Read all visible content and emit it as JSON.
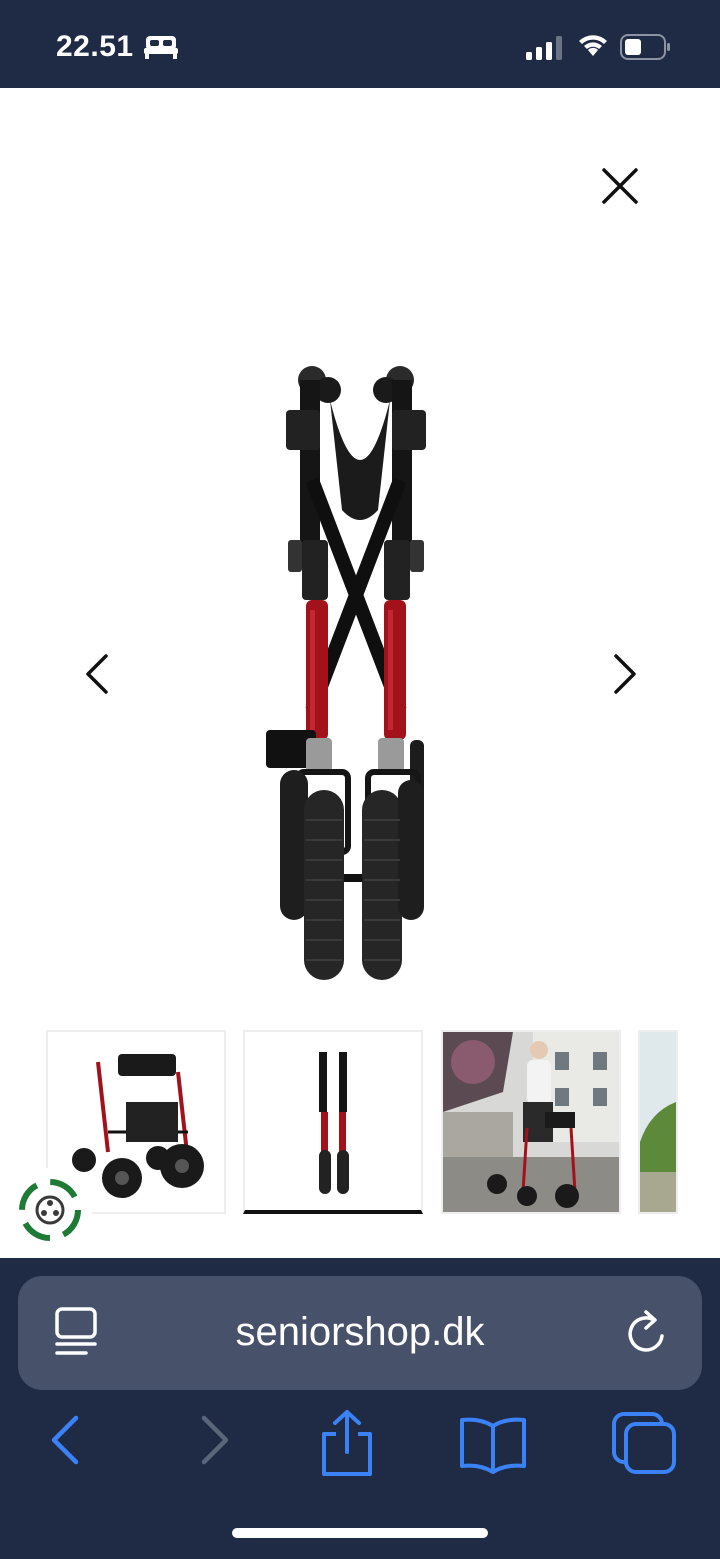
{
  "status_bar": {
    "time": "22.51",
    "icons": [
      "bed-icon",
      "cellular-signal-icon",
      "wifi-icon",
      "battery-icon"
    ],
    "background": "#1f2a44"
  },
  "viewer": {
    "close_icon": "close-icon",
    "prev_icon": "chevron-left-icon",
    "next_icon": "chevron-right-icon",
    "main_image": "folded-rollator-front-view",
    "thumbnails": [
      {
        "name": "rollator-side-view",
        "active": false
      },
      {
        "name": "rollator-folded-view",
        "active": true
      },
      {
        "name": "woman-with-rollator-street",
        "active": false
      },
      {
        "name": "outdoor-partial-view",
        "active": false
      }
    ],
    "eco_badge": "recycle-badge-icon"
  },
  "browser": {
    "url": "seniorshop.dk",
    "reader_icon": "reader-mode-icon",
    "reload_icon": "reload-icon",
    "toolbar": [
      "back-icon",
      "forward-icon",
      "share-icon",
      "bookmarks-icon",
      "tabs-icon"
    ],
    "accent": "#3b82f6",
    "background": "#1f2a44"
  }
}
